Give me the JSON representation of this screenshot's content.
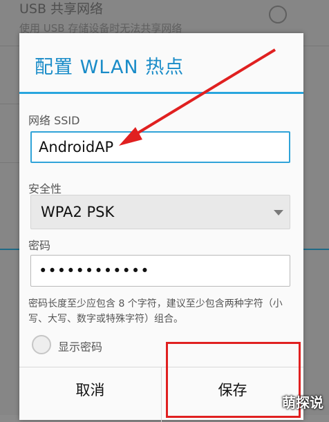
{
  "background": {
    "title": "USB 共享网络",
    "subtitle": "使用 USB 存储设备时无法共享网络"
  },
  "dialog": {
    "title": "配置 WLAN 热点",
    "ssid_label": "网络 SSID",
    "ssid_value": "AndroidAP",
    "security_label": "安全性",
    "security_value": "WPA2 PSK",
    "password_label": "密码",
    "password_value": "••••••••••••",
    "hint": "密码长度至少应包含 8 个字符，建议至少包含两种字符（小写、大写、数字或特殊字符）组合。",
    "show_password_label": "显示密码",
    "show_password_checked": false,
    "cancel_label": "取消",
    "save_label": "保存"
  },
  "watermark": "萌探说",
  "colors": {
    "accent": "#1a8cc8",
    "title_line": "#28a6de",
    "annotation": "#e02020"
  }
}
